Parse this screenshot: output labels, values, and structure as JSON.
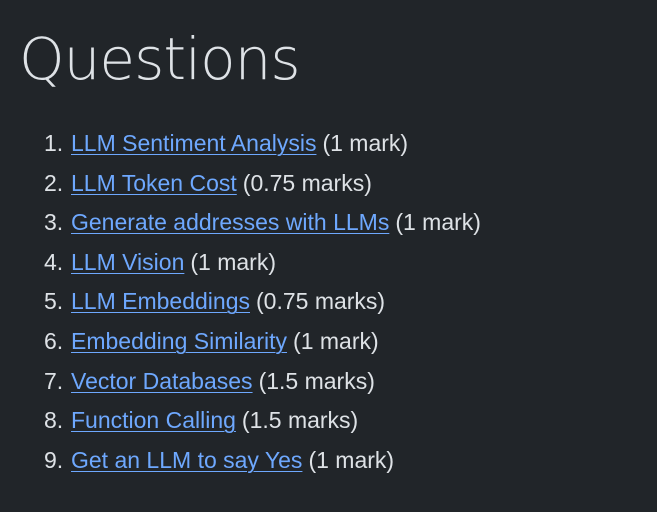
{
  "page": {
    "title": "Questions"
  },
  "questions": [
    {
      "number": "1.",
      "title": "LLM Sentiment Analysis",
      "marks": "(1 mark)"
    },
    {
      "number": "2.",
      "title": "LLM Token Cost",
      "marks": "(0.75 marks)"
    },
    {
      "number": "3.",
      "title": "Generate addresses with LLMs",
      "marks": "(1 mark)"
    },
    {
      "number": "4.",
      "title": "LLM Vision",
      "marks": "(1 mark)"
    },
    {
      "number": "5.",
      "title": "LLM Embeddings",
      "marks": "(0.75 marks)"
    },
    {
      "number": "6.",
      "title": "Embedding Similarity",
      "marks": "(1 mark)"
    },
    {
      "number": "7.",
      "title": "Vector Databases",
      "marks": "(1.5 marks)"
    },
    {
      "number": "8.",
      "title": "Function Calling",
      "marks": "(1.5 marks)"
    },
    {
      "number": "9.",
      "title": "Get an LLM to say Yes",
      "marks": "(1 mark)"
    }
  ],
  "colors": {
    "background": "#212529",
    "text": "#dee2e6",
    "link": "#6ea8fe"
  }
}
